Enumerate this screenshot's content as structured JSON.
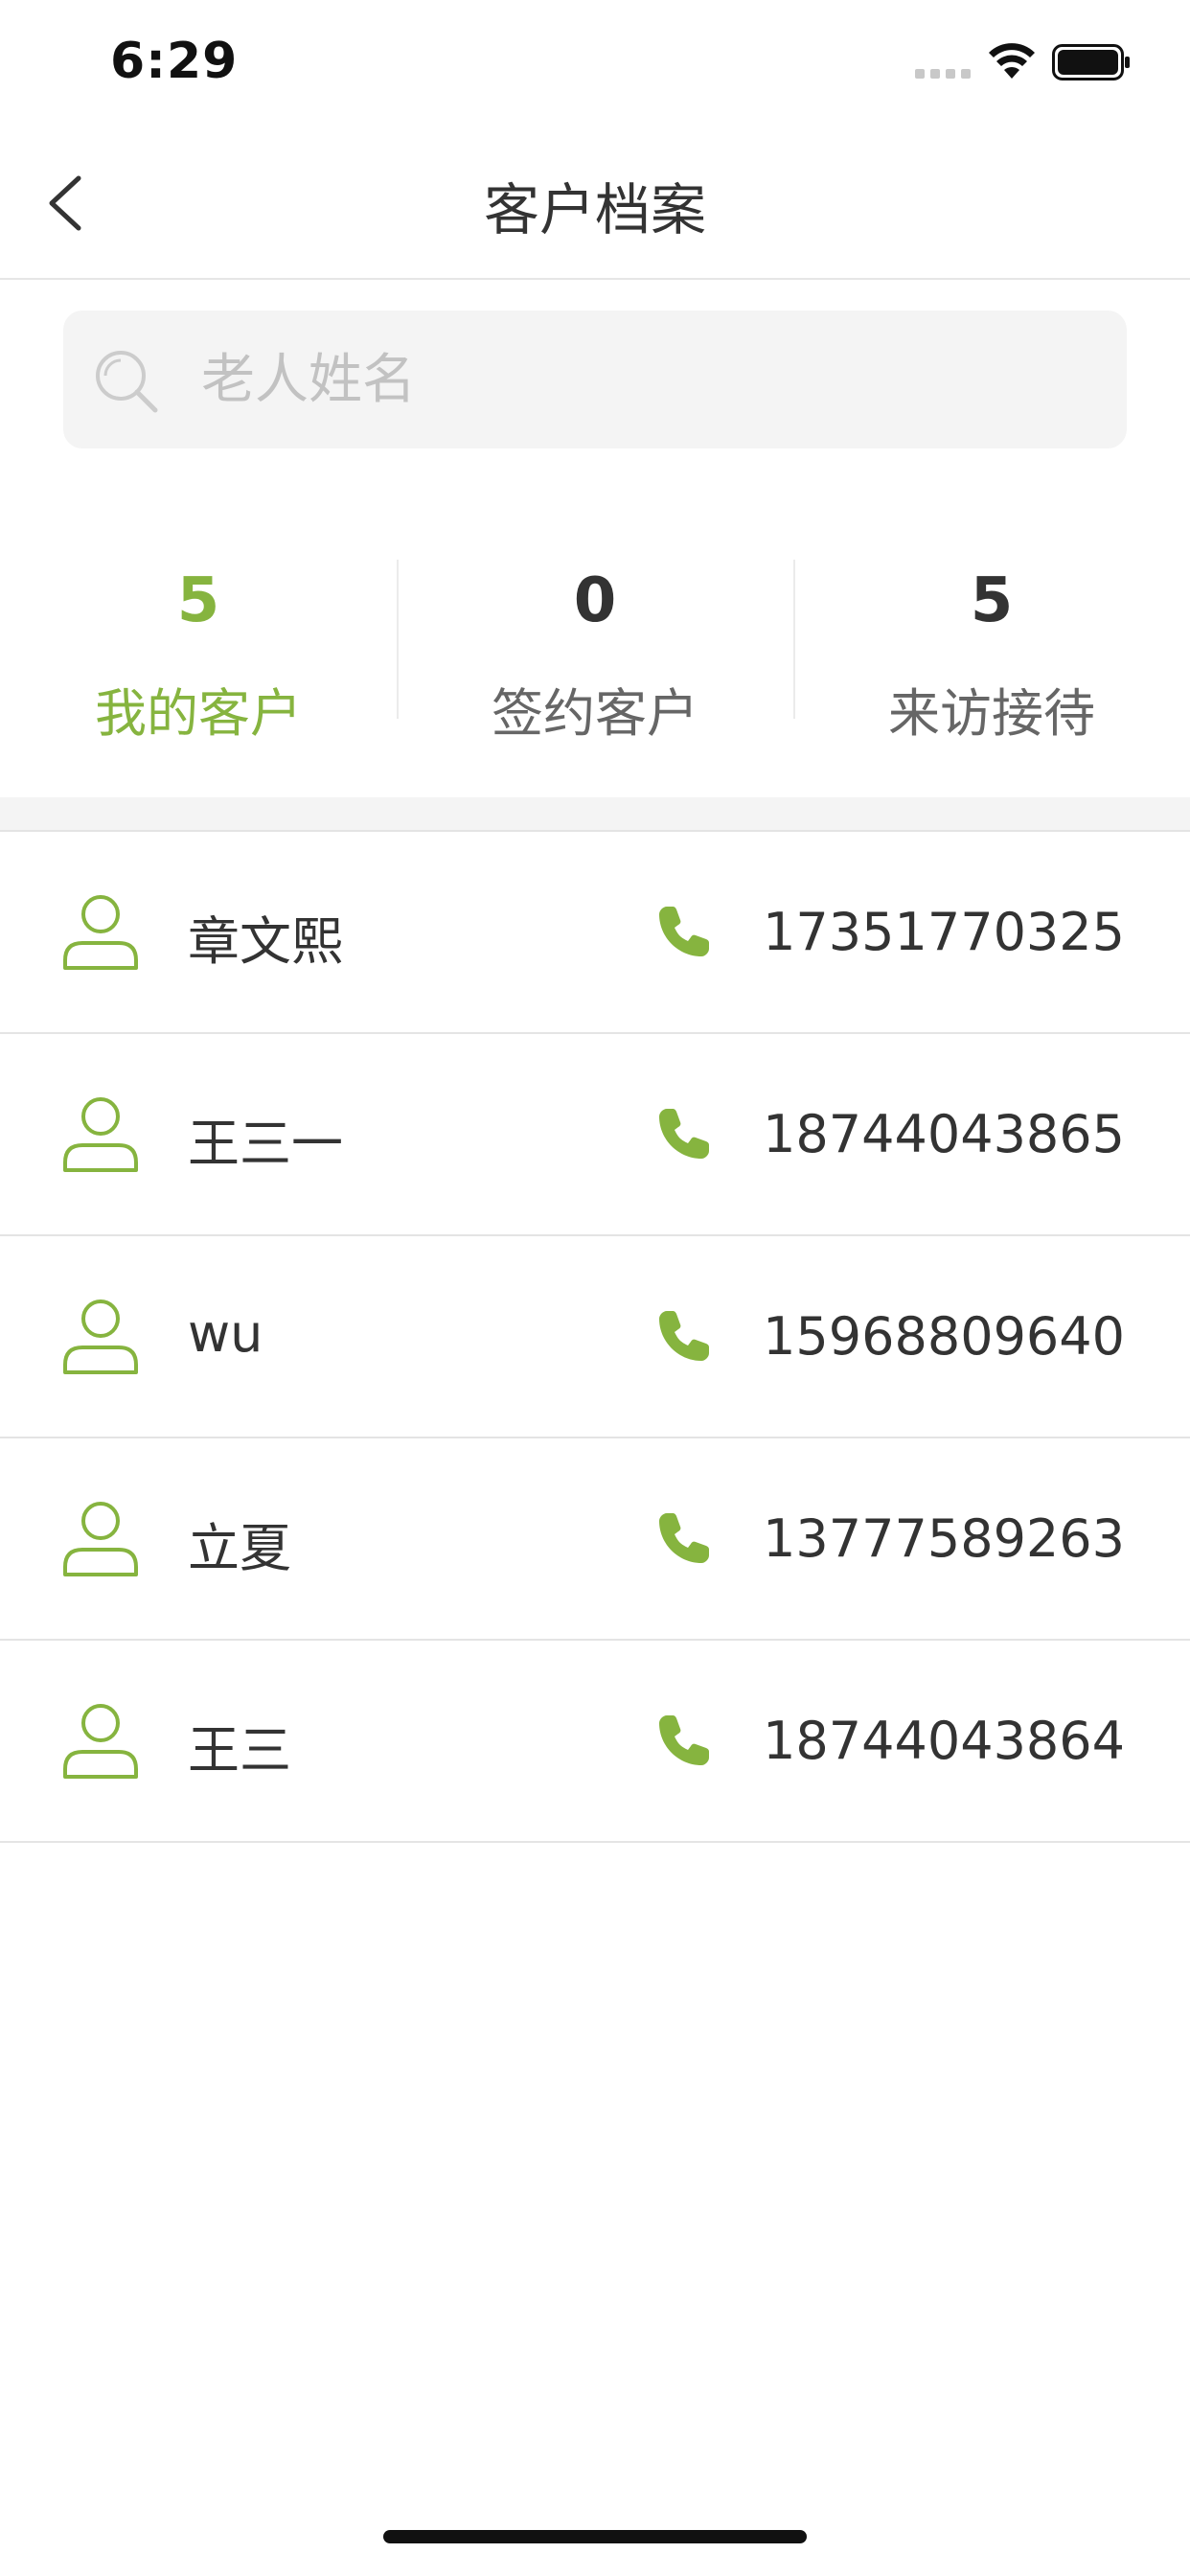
{
  "status_bar": {
    "time": "6:29",
    "icons": [
      "signal-icon",
      "wifi-icon",
      "battery-icon"
    ]
  },
  "nav": {
    "title": "客户档案",
    "back_icon": "chevron-left-icon"
  },
  "search": {
    "placeholder": "老人姓名",
    "value": "",
    "icon": "search-icon"
  },
  "stats": [
    {
      "value": "5",
      "label": "我的客户",
      "active": true
    },
    {
      "value": "0",
      "label": "签约客户",
      "active": false
    },
    {
      "value": "5",
      "label": "来访接待",
      "active": false
    }
  ],
  "customers": [
    {
      "name": "章文熙",
      "phone": "17351770325"
    },
    {
      "name": "王三一",
      "phone": "18744043865"
    },
    {
      "name": "wu",
      "phone": "15968809640"
    },
    {
      "name": "立夏",
      "phone": "13777589263"
    },
    {
      "name": "王三",
      "phone": "18744043864"
    }
  ],
  "colors": {
    "accent": "#86b43f",
    "text_primary": "#333333",
    "text_secondary": "#666666",
    "placeholder": "#c2c2c2",
    "divider": "#e4e4e4",
    "search_bg": "#f4f4f4"
  }
}
